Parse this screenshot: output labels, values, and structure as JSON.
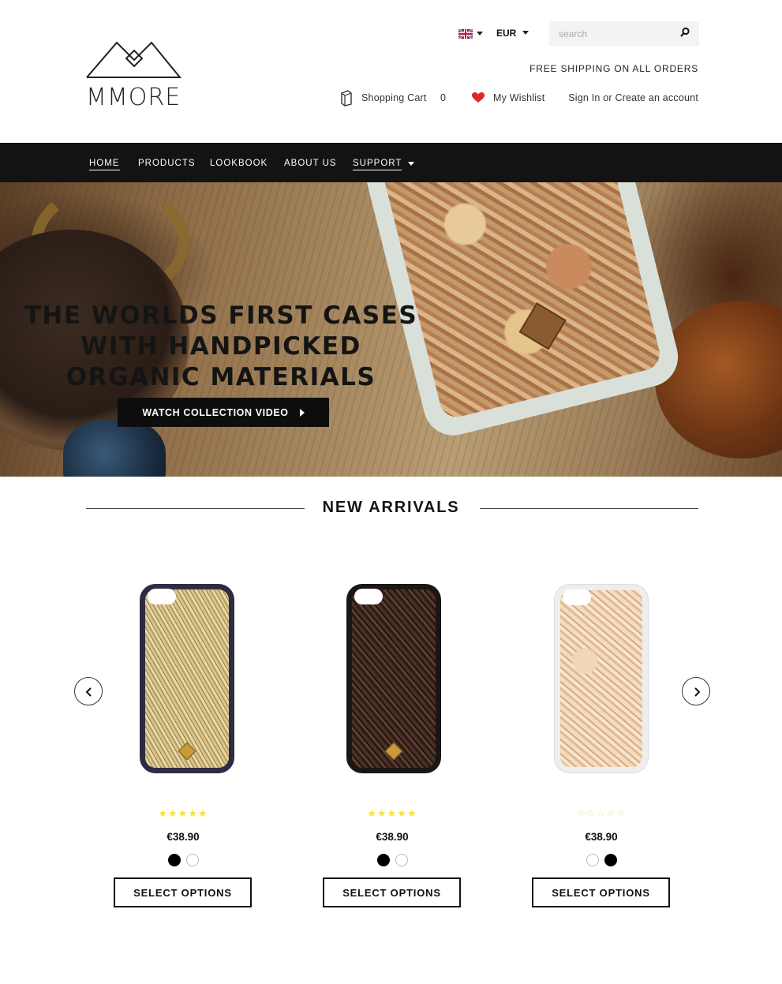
{
  "header": {
    "logo_text": "MMORE",
    "language": "English",
    "currency": "EUR",
    "search_placeholder": "search",
    "shipping_notice": "FREE SHIPPING ON ALL ORDERS",
    "cart_label": "Shopping Cart",
    "cart_count": "0",
    "wishlist_label": "My Wishlist",
    "signin_label": "Sign In or Create an account"
  },
  "nav": {
    "items": [
      {
        "label": "HOME",
        "active": true
      },
      {
        "label": "PRODUCTS"
      },
      {
        "label": "LOOKBOOK"
      },
      {
        "label": "ABOUT US"
      },
      {
        "label": "SUPPORT",
        "has_dropdown": true
      }
    ]
  },
  "hero": {
    "title": "THE WORLDS FIRST CASES WITH HANDPICKED ORGANIC MATERIALS",
    "cta_label": "WATCH COLLECTION VIDEO"
  },
  "new_arrivals": {
    "title": "NEW ARRIVALS",
    "products": [
      {
        "rating": 5,
        "stars": "★★★★★",
        "price": "€38.90",
        "colors": [
          "black",
          "white"
        ],
        "selected_color": "black",
        "button": "SELECT OPTIONS"
      },
      {
        "rating": 5,
        "stars": "★★★★★",
        "price": "€38.90",
        "colors": [
          "black",
          "white"
        ],
        "selected_color": "black",
        "button": "SELECT OPTIONS"
      },
      {
        "rating": 0,
        "stars": "☆☆☆☆☆",
        "price": "€38.90",
        "colors": [
          "white",
          "black"
        ],
        "selected_color": "white",
        "button": "SELECT OPTIONS"
      }
    ]
  },
  "colors": {
    "nav_background": "#131313",
    "star": "#f7e23b",
    "wishlist_heart": "#d9282f"
  }
}
